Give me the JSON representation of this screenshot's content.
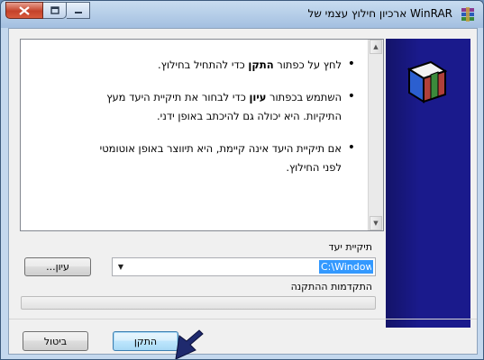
{
  "window": {
    "title": "WinRAR ארכיון חילוץ עצמי של",
    "caption_buttons": [
      "close-icon",
      "maximize-icon",
      "minimize-icon"
    ]
  },
  "instructions": [
    {
      "lines": [
        [
          {
            "t": "לחץ על כפתור "
          },
          {
            "t": "התקן",
            "b": true
          },
          {
            "t": " כדי להתחיל בחילוץ."
          }
        ]
      ]
    },
    {
      "lines": [
        [
          {
            "t": "השתמש בכפתור "
          },
          {
            "t": "עיון",
            "b": true
          },
          {
            "t": " כדי לבחור את תיקיית היעד מעץ"
          }
        ],
        [
          {
            "t": "התיקיות. היא יכולה גם להיכתב באופן ידני."
          }
        ]
      ]
    },
    {
      "lines": [
        [
          {
            "t": "אם תיקיית היעד אינה קיימת, היא תיווצר באופן אוטומטי"
          }
        ],
        [
          {
            "t": "לפני החילוץ."
          }
        ]
      ]
    }
  ],
  "destination": {
    "label": "תיקיית יעד",
    "value": "C:\\Windows",
    "browse_label": "עיון..."
  },
  "progress": {
    "label": "התקדמות ההתקנה",
    "fraction": 0
  },
  "buttons": {
    "install_label": "התקן",
    "cancel_label": "ביטול"
  },
  "colors": {
    "banner": "#1a1a8c",
    "selection": "#3399ff"
  }
}
